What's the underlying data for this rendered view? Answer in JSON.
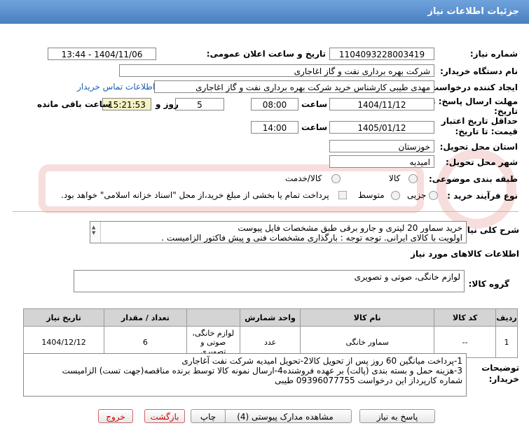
{
  "header": {
    "title": "جزئیات اطلاعات نیاز"
  },
  "form": {
    "need_number_label": "شماره نیاز:",
    "need_number": "1104093228003419",
    "announce_label": "تاریخ و ساعت اعلان عمومی:",
    "announce_value": "1404/11/06 - 13:44",
    "buyer_org_label": "نام دستگاه خریدار:",
    "buyer_org": "شرکت بهره برداری نفت و گاز اغاجاری",
    "creator_label": "ایجاد کننده درخواست:",
    "creator": "مهدی طیبی کارشناس خرید شرکت بهره برداری نفت و گاز اغاجاری",
    "contact_link": "اطلاعات تماس خریدار",
    "deadline_label_1": "مهلت ارسال پاسخ: تا",
    "deadline_label_2": "تاریخ:",
    "deadline_date": "1404/11/12",
    "time_label": "ساعت",
    "deadline_time": "08:00",
    "days_value": "5",
    "days_label": "روز و",
    "remaining_time": "15:21:53",
    "remaining_label": "ساعت باقی مانده",
    "validity_label_1": "حداقل تاریخ اعتبار",
    "validity_label_2": "قیمت: تا تاریخ:",
    "validity_date": "1405/01/12",
    "validity_time": "14:00",
    "province_label": "استان محل تحویل:",
    "province": "خوزستان",
    "city_label": "شهر محل تحویل:",
    "city": "امیدیه",
    "category_label": "طبقه بندی موضوعی:",
    "category_goods": "کالا",
    "category_goods_services": "کالا/خدمت",
    "process_label": "نوع فرآیند خرید :",
    "process_partial": "جزیی",
    "process_medium": "متوسط",
    "payment_note": "پرداخت تمام یا بخشی از مبلغ خرید،از محل \"اسناد خزانه اسلامی\" خواهد بود."
  },
  "summary": {
    "label": "شرح کلی نیاز:",
    "line1": "خرید سماور 20 لیتری و جارو برقی طبق مشخصات فایل پیوست",
    "line2": "اولویت با کالای ایرانی. توجه توجه : بارگذاری مشخصات فنی و پیش فاکتور الزامیست ."
  },
  "goods_info": {
    "section_title": "اطلاعات کالاهای مورد نیاز",
    "group_label": "گروه کالا:",
    "group_value": "لوازم خانگی، صوتی و تصویری"
  },
  "table": {
    "headers": {
      "row": "ردیف",
      "code": "کد کالا",
      "name": "نام کالا",
      "unit": "واحد شمارش",
      "qty": "تعداد / مقدار",
      "date": "تاریخ نیاز"
    },
    "rows": [
      {
        "row": "1",
        "code": "--",
        "name": "سماور خانگی",
        "unit": "عدد",
        "group_line1": "لوازم خانگی،",
        "group_line2": "صوتی و تصویری",
        "qty": "6",
        "date": "1404/12/12"
      }
    ]
  },
  "notes": {
    "label_1": "توضیحات",
    "label_2": "خریدار:",
    "line1": "1-پرداخت میانگین 60 روز پس از تحویل کالا2-تحویل امیدیه شرکت نفت آغاجاری",
    "line2": "3-هزینه حمل  و بسته بندی (پالت) بر عهده فروشنده4-ارسال نمونه کالا توسط برنده مناقصه(جهت تست) الزامیست",
    "line3": "شماره کارپرداز این درخواست 09396077755 طیبی"
  },
  "buttons": {
    "reply": "پاسخ به نیاز",
    "attachments": "مشاهده مدارک پیوستی (4)",
    "print": "چاپ",
    "back": "بازگشت",
    "exit": "خروج"
  },
  "colors": {
    "header": "#5a8fd0",
    "link": "#1a5fb4",
    "highlight": "#f5f3c3"
  }
}
